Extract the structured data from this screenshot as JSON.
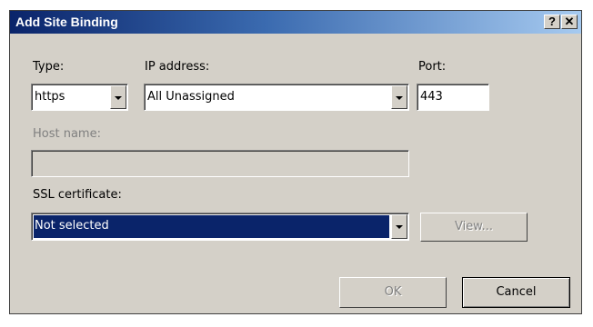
{
  "dialog": {
    "title": "Add Site Binding",
    "help_label": "?",
    "close_label": "✕"
  },
  "type": {
    "label": "Type:",
    "value": "https"
  },
  "ip": {
    "label": "IP address:",
    "value": "All Unassigned"
  },
  "port": {
    "label": "Port:",
    "value": "443"
  },
  "host": {
    "label": "Host name:",
    "value": ""
  },
  "ssl": {
    "label": "SSL certificate:",
    "value": "Not selected"
  },
  "buttons": {
    "view": "View...",
    "ok": "OK",
    "cancel": "Cancel"
  },
  "colors": {
    "title_start": "#0a246a",
    "title_end": "#a6caf0",
    "selection": "#0a246a",
    "face": "#d4d0c8"
  }
}
